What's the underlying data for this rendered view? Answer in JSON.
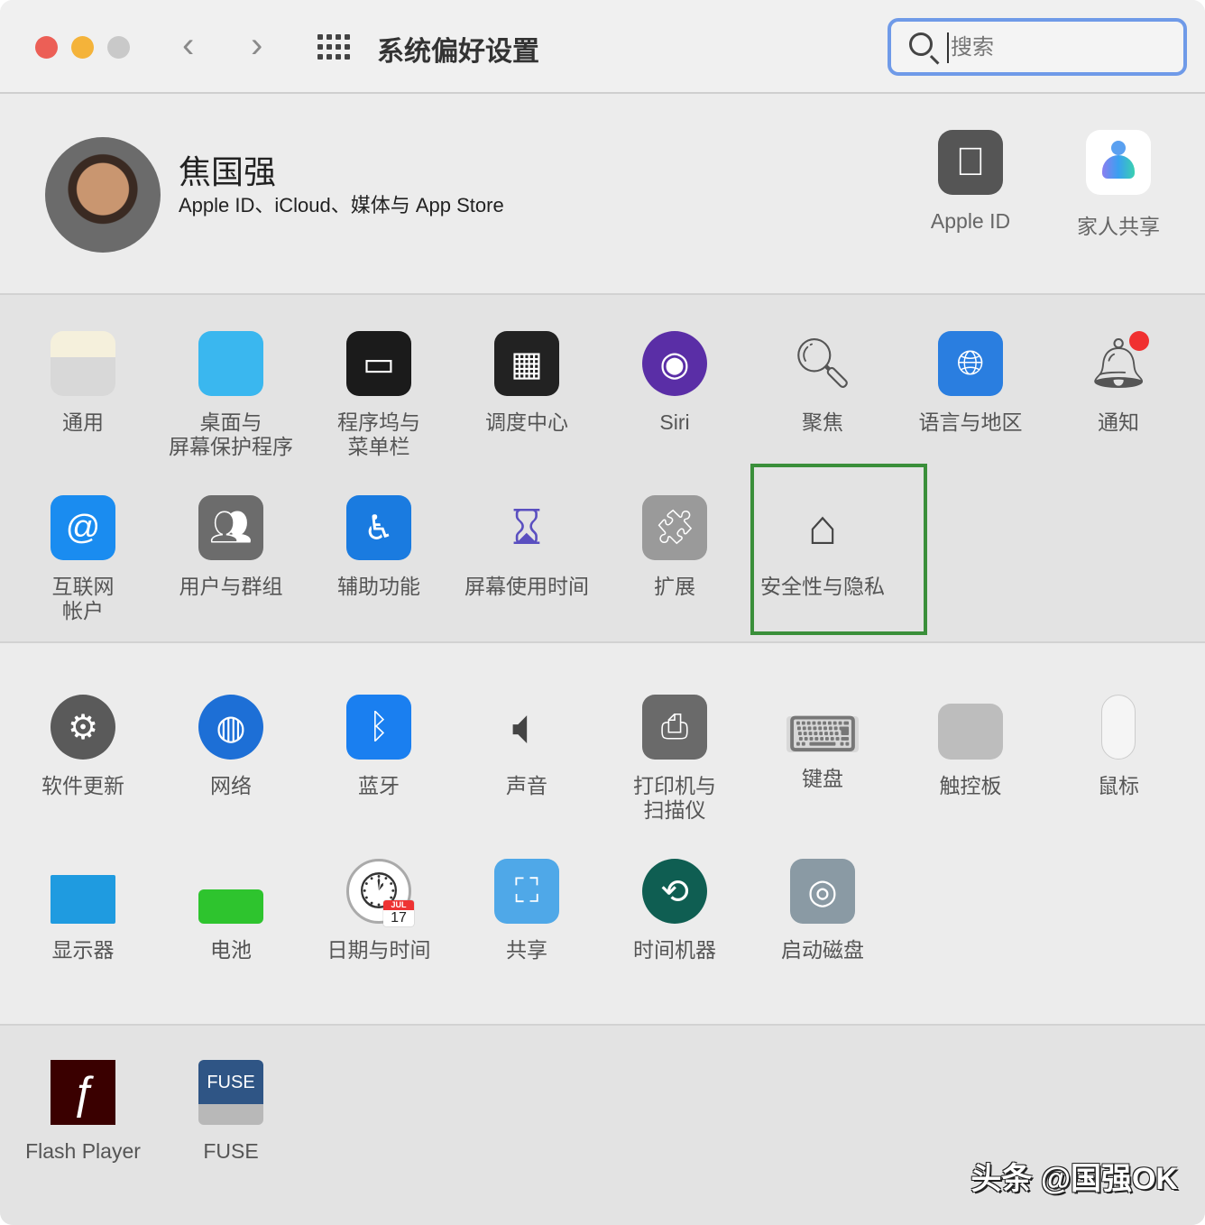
{
  "window": {
    "title": "系统偏好设置",
    "traffic_lights": {
      "close": "#ec5f56",
      "minimize": "#f4b33a",
      "zoom": "#c9c9c9"
    },
    "back_icon": "chevron-left-icon",
    "forward_icon": "chevron-right-icon",
    "grid_icon": "show-all-grid-icon"
  },
  "search": {
    "placeholder": "搜索",
    "value": "",
    "focus_color": "#6f9ae8"
  },
  "account": {
    "name": "焦国强",
    "subtitle": "Apple ID、iCloud、媒体与 App Store",
    "items": [
      {
        "label": "Apple ID",
        "icon": "apple-logo-icon",
        "color": "#555555"
      },
      {
        "label": "家人共享",
        "icon": "family-sharing-icon",
        "color": "#ffffff"
      }
    ]
  },
  "sections": [
    {
      "rows": [
        [
          {
            "label": "通用",
            "icon": "general-icon",
            "color": "#e8e3d2"
          },
          {
            "label": "桌面与\n屏幕保护程序",
            "icon": "desktop-icon",
            "color": "#3ab7ef"
          },
          {
            "label": "程序坞与\n菜单栏",
            "icon": "dock-icon",
            "color": "#1b1b1b"
          },
          {
            "label": "调度中心",
            "icon": "mission-control-icon",
            "color": "#222222"
          },
          {
            "label": "Siri",
            "icon": "siri-icon",
            "color": "#5a2ea6"
          },
          {
            "label": "聚焦",
            "icon": "spotlight-magnifier-icon",
            "color": "transparent"
          },
          {
            "label": "语言与地区",
            "icon": "flag-globe-icon",
            "color": "#2a7ee0"
          },
          {
            "label": "通知",
            "icon": "bell-icon",
            "color": "transparent"
          }
        ],
        [
          {
            "label": "互联网\n帐户",
            "icon": "at-icon",
            "color": "#1a8cf0"
          },
          {
            "label": "用户与群组",
            "icon": "users-icon",
            "color": "#6c6c6c"
          },
          {
            "label": "辅助功能",
            "icon": "accessibility-icon",
            "color": "#1a7be0"
          },
          {
            "label": "屏幕使用时间",
            "icon": "hourglass-icon",
            "color": "transparent"
          },
          {
            "label": "扩展",
            "icon": "puzzle-icon",
            "color": "#9a9a9a"
          },
          {
            "label": "安全性与隐私",
            "icon": "house-lock-icon",
            "color": "transparent",
            "highlighted": true
          }
        ]
      ]
    },
    {
      "rows": [
        [
          {
            "label": "软件更新",
            "icon": "gear-icon",
            "color": "#5a5a5a"
          },
          {
            "label": "网络",
            "icon": "globe-network-icon",
            "color": "#1d6fd6"
          },
          {
            "label": "蓝牙",
            "icon": "bluetooth-icon",
            "color": "#1a7ff0"
          },
          {
            "label": "声音",
            "icon": "speaker-icon",
            "color": "transparent"
          },
          {
            "label": "打印机与\n扫描仪",
            "icon": "printer-icon",
            "color": "#6a6a6a"
          },
          {
            "label": "键盘",
            "icon": "keyboard-icon",
            "color": "#d8d8d8"
          },
          {
            "label": "触控板",
            "icon": "trackpad-icon",
            "color": "#bdbdbd"
          },
          {
            "label": "鼠标",
            "icon": "mouse-icon",
            "color": "#f5f5f5"
          }
        ],
        [
          {
            "label": "显示器",
            "icon": "display-icon",
            "color": "#1f9be0"
          },
          {
            "label": "电池",
            "icon": "battery-icon",
            "color": "#2ec42e"
          },
          {
            "label": "日期与时间",
            "icon": "clock-calendar-icon",
            "color": "#ffffff",
            "badge": "17",
            "badge_month": "JUL"
          },
          {
            "label": "共享",
            "icon": "sharing-folder-icon",
            "color": "#4fa8e8"
          },
          {
            "label": "时间机器",
            "icon": "time-machine-icon",
            "color": "#0f5e52"
          },
          {
            "label": "启动磁盘",
            "icon": "hard-disk-icon",
            "color": "#8a9aa4"
          }
        ]
      ]
    },
    {
      "rows": [
        [
          {
            "label": "Flash Player",
            "icon": "flash-player-icon",
            "color": "#3a0000"
          },
          {
            "label": "FUSE",
            "icon": "fuse-drive-icon",
            "color": "#2f5585",
            "icon_text": "FUSE"
          }
        ]
      ]
    }
  ],
  "highlight_color": "#3a8f3a",
  "watermark": "头条 @国强OK"
}
